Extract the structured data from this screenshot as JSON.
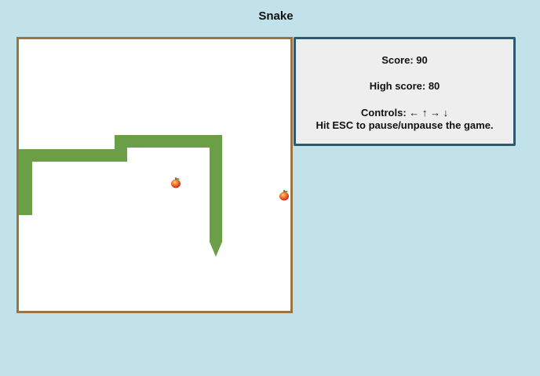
{
  "game": {
    "title": "Snake"
  },
  "panel": {
    "score_text": "Score: 90",
    "high_score_text": "High score: 80",
    "controls_text": "Controls: ← ↑ → ↓",
    "pause_hint_text": "Hit ESC to pause/unpause the game."
  },
  "board": {
    "snake_color": "#6a9f48",
    "apple_color": "#e8452c",
    "snake_heading": "down",
    "apple_count": 2
  },
  "colors": {
    "background": "#c2e2ea",
    "board_border": "#9b7442",
    "panel_border": "#2e5a70",
    "panel_background": "#eeeeee"
  }
}
